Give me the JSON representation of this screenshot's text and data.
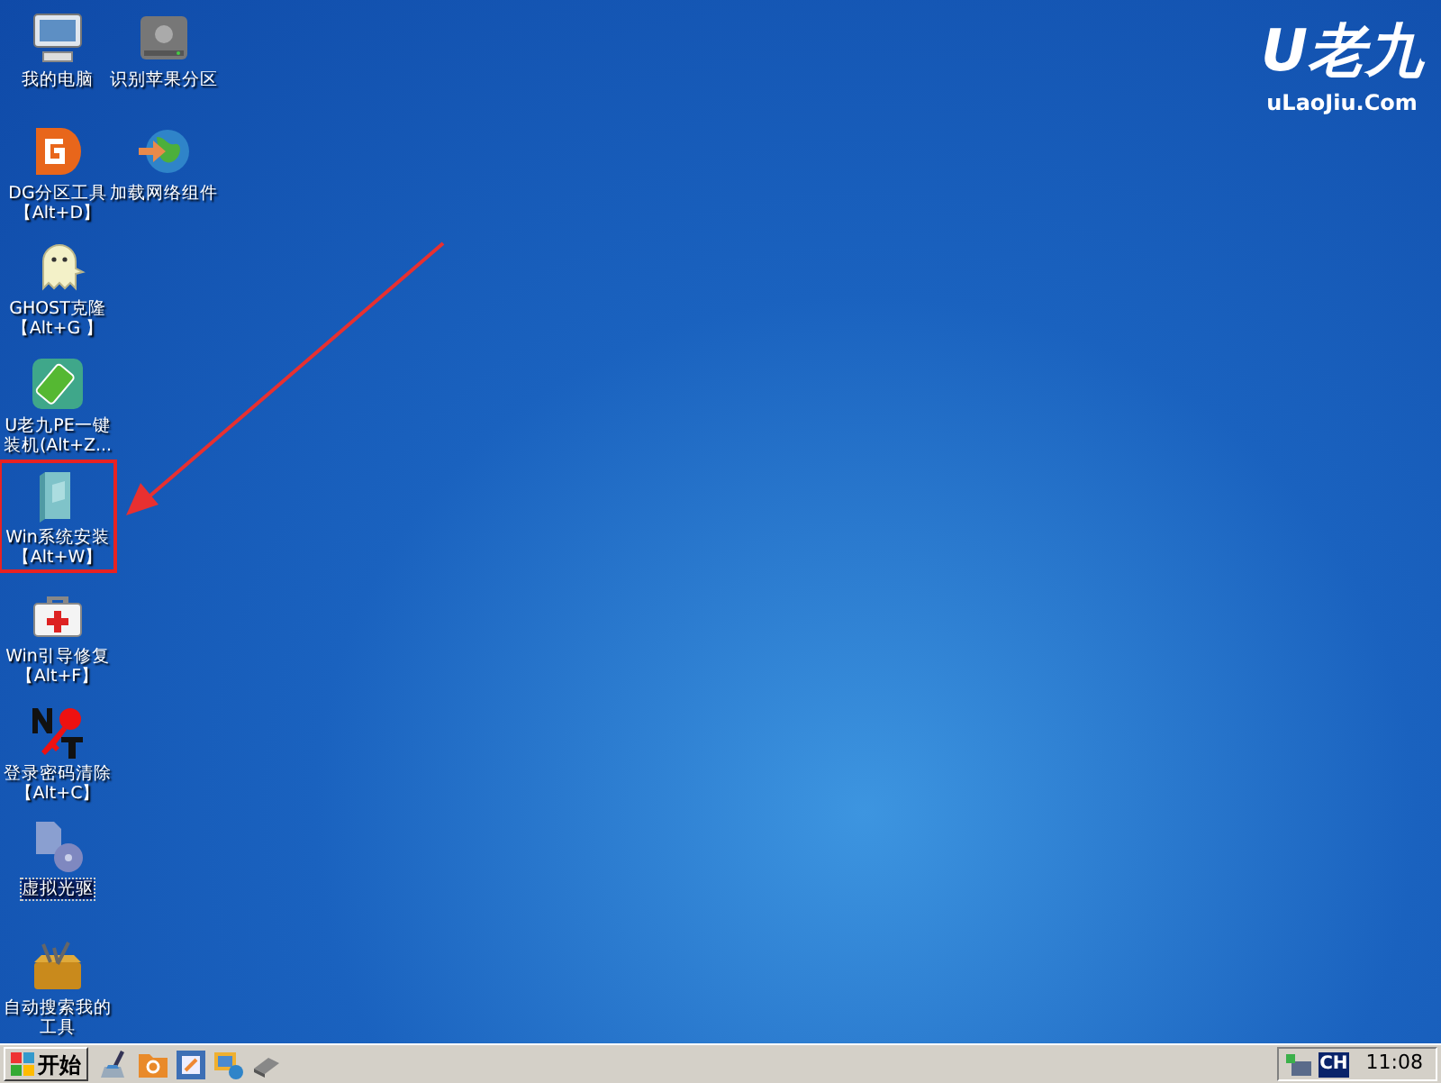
{
  "logo": {
    "title": "U老九",
    "subtitle": "uLaoJiu.Com"
  },
  "icons": [
    {
      "kind": "computer",
      "lines": [
        "我的电脑"
      ],
      "selected": false,
      "highlighted": false
    },
    {
      "kind": "drive",
      "lines": [
        "识别苹果分区"
      ],
      "selected": false,
      "highlighted": false
    },
    {
      "kind": "dg",
      "lines": [
        "DG分区工具",
        "【Alt+D】"
      ],
      "selected": false,
      "highlighted": false
    },
    {
      "kind": "globe",
      "lines": [
        "加载网络组件"
      ],
      "selected": false,
      "highlighted": false
    },
    {
      "kind": "ghost",
      "lines": [
        "GHOST克隆",
        "【Alt+G 】"
      ],
      "selected": false,
      "highlighted": false
    },
    {
      "kind": "usb",
      "lines": [
        "U老九PE一键",
        "装机(Alt+Z..."
      ],
      "selected": false,
      "highlighted": false
    },
    {
      "kind": "disk",
      "lines": [
        "Win系统安装",
        "【Alt+W】"
      ],
      "selected": false,
      "highlighted": true
    },
    {
      "kind": "firstaid",
      "lines": [
        "Win引导修复",
        "【Alt+F】"
      ],
      "selected": false,
      "highlighted": false
    },
    {
      "kind": "key",
      "lines": [
        "登录密码清除",
        "【Alt+C】"
      ],
      "selected": false,
      "highlighted": false
    },
    {
      "kind": "cd",
      "lines": [
        "虚拟光驱"
      ],
      "selected": true,
      "highlighted": false
    },
    {
      "kind": "toolbox",
      "lines": [
        "自动搜索我的",
        "工具"
      ],
      "selected": false,
      "highlighted": false
    }
  ],
  "taskbar": {
    "start": "开始",
    "quick_launch": [
      {
        "kind": "cleaner"
      },
      {
        "kind": "folder"
      },
      {
        "kind": "capture"
      },
      {
        "kind": "network"
      },
      {
        "kind": "eraser"
      }
    ],
    "tray": {
      "language": "CH",
      "time": "11:08"
    }
  }
}
